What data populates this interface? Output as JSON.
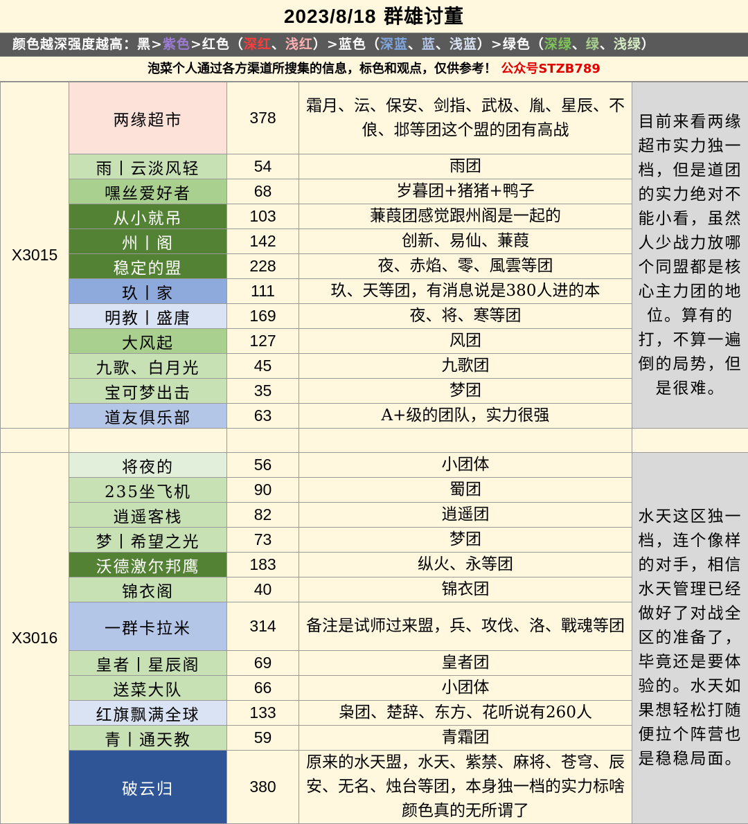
{
  "header": {
    "title_date": "2023/8/18",
    "title_text": "群雄讨董"
  },
  "legend": {
    "prefix": "颜色越深强度越高：黑>",
    "purple": "紫色",
    "red_part": ">红色（",
    "deep_red": "深红",
    "sep1": "、",
    "light_red": "浅红",
    "blue_part": "）>蓝色（",
    "deep_blue": "深蓝",
    "sep2": "、",
    "blue": "蓝",
    "sep3": "、",
    "light_blue": "浅蓝",
    "green_part": "）>绿色（",
    "deep_green": "深绿",
    "sep4": "、",
    "green": "绿",
    "sep5": "、",
    "light_green": "浅绿",
    "end": "）",
    "colors": {
      "purple": "#9b7bd4",
      "deep_red": "#ff3b3b",
      "light_red": "#ffb0b0",
      "deep_blue": "#7fa7e0",
      "blue": "#b4c6e7",
      "light_blue": "#dae3f3",
      "deep_green": "#7fc35a",
      "green": "#a9d08e",
      "light_green": "#d6ecc6"
    }
  },
  "note": {
    "text": "泡菜个人通过各方渠道所搜集的信息，标色和观点，仅供参考！",
    "account": "公众号STZB789"
  },
  "sections": [
    {
      "server": "X3015",
      "comment": "目前来看两缘超市实力独一档，但是道团的实力绝对不能小看，虽然人少战力放哪个同盟都是核心主力团的地位。算有的打，不算一遍倒的局势，但是很难。",
      "rows": [
        {
          "name": "两缘超市",
          "count": "378",
          "desc": "霜月、沄、保安、剑指、武极、胤、星辰、不俍、邶等团这个盟的团有高战",
          "color": "pink"
        },
        {
          "name": "雨丨云淡风轻",
          "count": "54",
          "desc": "雨团",
          "color": "lgreen"
        },
        {
          "name": "嘿丝爱好者",
          "count": "68",
          "desc": "岁暮团+猪猪+鸭子",
          "color": "green"
        },
        {
          "name": "从小就吊",
          "count": "103",
          "desc": "蒹葭团感觉跟州阁是一起的",
          "color": "dgreen"
        },
        {
          "name": "州丨阁",
          "count": "142",
          "desc": "创新、易仙、蒹葭",
          "color": "dgreen"
        },
        {
          "name": "稳定的盟",
          "count": "228",
          "desc": "夜、赤焰、零、風雲等团",
          "color": "dgreen"
        },
        {
          "name": "玖丨家",
          "count": "111",
          "desc": "玖、天等团，有消息说是380人进的本",
          "color": "dblue"
        },
        {
          "name": "明教丨盛唐",
          "count": "169",
          "desc": "夜、将、寒等团",
          "color": "lblue"
        },
        {
          "name": "大风起",
          "count": "127",
          "desc": "风团",
          "color": "green"
        },
        {
          "name": "九歌、白月光",
          "count": "45",
          "desc": "九歌团",
          "color": "lgreen"
        },
        {
          "name": "宝可梦出击",
          "count": "35",
          "desc": "梦团",
          "color": "lgreen"
        },
        {
          "name": "道友俱乐部",
          "count": "63",
          "desc": "A+级的团队，实力很强",
          "color": "blue"
        }
      ]
    },
    {
      "server": "X3016",
      "comment": "水天这区独一档，连个像样的对手，相信水天管理已经做好了对战全区的准备了，毕竟还是要体验的。水天如果想轻松打随便拉个阵营也是稳稳局面。",
      "rows": [
        {
          "name": "将夜的",
          "count": "56",
          "desc": "小团体",
          "color": "pale"
        },
        {
          "name": "235坐飞机",
          "count": "90",
          "desc": "蜀团",
          "color": "lgreen"
        },
        {
          "name": "逍遥客栈",
          "count": "82",
          "desc": "逍遥团",
          "color": "lgreen"
        },
        {
          "name": "梦丨希望之光",
          "count": "73",
          "desc": "梦团",
          "color": "lgreen"
        },
        {
          "name": "沃德激尔邦鹰",
          "count": "183",
          "desc": "纵火、永等团",
          "color": "dgreen"
        },
        {
          "name": "锦衣阁",
          "count": "40",
          "desc": "锦衣团",
          "color": "lgreen"
        },
        {
          "name": "一群卡拉米",
          "count": "314",
          "desc": "备注是试师过来盟，兵、攻伐、洛、戰魂等团",
          "color": "blue"
        },
        {
          "name": "皇者丨星辰阁",
          "count": "69",
          "desc": "皇者团",
          "color": "lgreen"
        },
        {
          "name": "送菜大队",
          "count": "66",
          "desc": "小团体",
          "color": "lgreen"
        },
        {
          "name": "红旗飘满全球",
          "count": "133",
          "desc": "枭团、楚辞、东方、花听说有260人",
          "color": "lblue"
        },
        {
          "name": "青丨通天教",
          "count": "59",
          "desc": "青霜团",
          "color": "lgreen"
        },
        {
          "name": "破云归",
          "count": "380",
          "desc": "原来的水天盟，水天、紫禁、麻将、苍穹、辰安、无名、烛台等团，本身独一档的实力标啥颜色真的无所谓了",
          "color": "navy"
        }
      ]
    }
  ]
}
